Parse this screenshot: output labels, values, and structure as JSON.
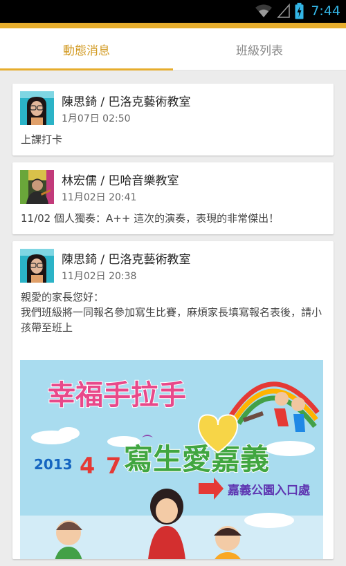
{
  "status": {
    "time": "7:44"
  },
  "tabs": [
    {
      "label": "動態消息",
      "active": true
    },
    {
      "label": "班級列表",
      "active": false
    }
  ],
  "posts": [
    {
      "author": "陳思錡 / 巴洛克藝術教室",
      "time": "1月07日 02:50",
      "text": "上課打卡"
    },
    {
      "author": "林宏儒 / 巴哈音樂教室",
      "time": "11月02日 20:41",
      "text": "11/02 個人獨奏：A++ 這次的演奏，表現的非常傑出！"
    },
    {
      "author": "陳思錡 / 巴洛克藝術教室",
      "time": "11月02日 20:38",
      "text": "親愛的家長您好：\n我們班級將一同報名參加寫生比賽，麻煩家長填寫報名表後，請小孩帶至班上"
    }
  ],
  "poster": {
    "title_line1": "幸福手拉手",
    "title_line2": "寫生愛嘉義",
    "date_year": "2013",
    "date_month": "4",
    "date_day": "7",
    "location": "嘉義公園入口處"
  },
  "colors": {
    "accent": "#e6ad2d",
    "status_blue": "#33b5e5"
  }
}
